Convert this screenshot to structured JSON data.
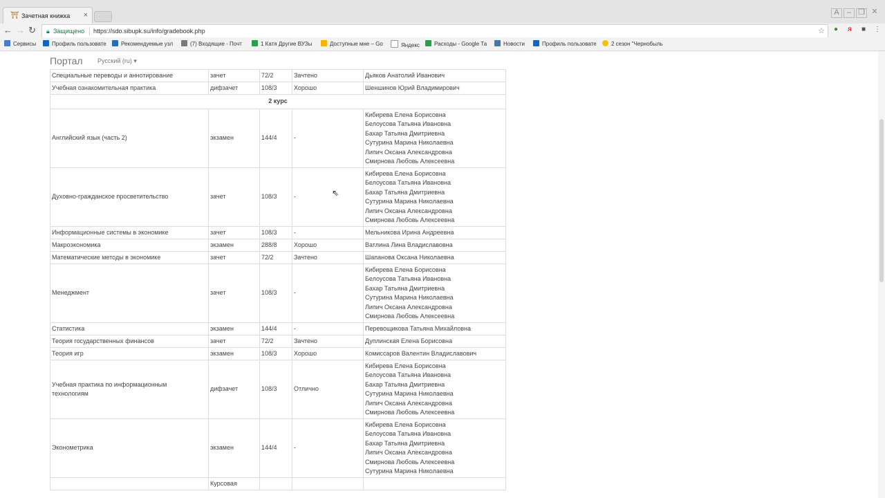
{
  "browser": {
    "tab_title": "Зачетная книжка",
    "tab_icon": "book-icon",
    "secure_label": "Защищено",
    "url": "https://sdo.sibupk.su/info/gradebook.php",
    "bookmarks": [
      "Сервисы",
      "Профиль пользовате",
      "Рекомендуемые узл",
      "(7) Входящие - Почт",
      "1 Катя Другие ВУЗы",
      "Доступные мне – Go",
      "Яндекс",
      "Расходы - Google Та",
      "Новости",
      "Профиль пользовате",
      "2 сезон \"Чернобыль"
    ]
  },
  "portal": {
    "brand": "Портал",
    "language": "Русский (ru) ▾"
  },
  "gradebook": {
    "rows_before": [
      [
        "Специальные переводы и аннотирование",
        "зачет",
        "72/2",
        "Зачтено",
        "Дьяков Анатолий Иванович"
      ],
      [
        "Учебная ознакомительная практика",
        "дифзачет",
        "108/3",
        "Хорошо",
        "Шеншинов Юрий Владимирович"
      ]
    ],
    "year_label": "2 курс",
    "rows": [
      [
        "Английский язык (часть 2)",
        "экзамен",
        "144/4",
        "-",
        "Кибирева Елена Борисовна\nБелоусова Татьяна Ивановна\nБахар Татьяна Дмитриевна\nСутурина Марина Николаевна\nЛипич Оксана Александровна\nСмирнова Любовь Алексеевна"
      ],
      [
        "Духовно-гражданское просветительство",
        "зачет",
        "108/3",
        "-",
        "Кибирева Елена Борисовна\nБелоусова Татьяна Ивановна\nБахар Татьяна Дмитриевна\nСутурина Марина Николаевна\nЛипич Оксана Александровна\nСмирнова Любовь Алексеевна"
      ],
      [
        "Информационные системы в экономике",
        "зачет",
        "108/3",
        "-",
        "Мельникова Ирина Андреевна"
      ],
      [
        "Макроэкономика",
        "экзамен",
        "288/8",
        "Хорошо",
        "Ватлина Лина Владиславовна"
      ],
      [
        "Математические методы в экономике",
        "зачет",
        "72/2",
        "Зачтено",
        "Шапанова Оксана Николаевна"
      ],
      [
        "Менеджмент",
        "зачет",
        "108/3",
        "-",
        "Кибирева Елена Борисовна\nБелоусова Татьяна Ивановна\nБахар Татьяна Дмитриевна\nСутурина Марина Николаевна\nЛипич Оксана Александровна\nСмирнова Любовь Алексеевна"
      ],
      [
        "Статистика",
        "экзамен",
        "144/4",
        "-",
        "Перевощикова Татьяна Михайловна"
      ],
      [
        "Теория государственных финансов",
        "зачет",
        "72/2",
        "Зачтено",
        "Дуплинская Елена Борисовна"
      ],
      [
        "Теория игр",
        "экзамен",
        "108/3",
        "Хорошо",
        "Комиссаров Валентин Владиславович"
      ],
      [
        "Учебная практика по информационным\nтехнологиям",
        "дифзачет",
        "108/3",
        "Отлично",
        "Кибирева Елена Борисовна\nБелоусова Татьяна Ивановна\nБахар Татьяна Дмитриевна\nСутурина Марина Николаевна\nЛипич Оксана Александровна\nСмирнова Любовь Алексеевна"
      ],
      [
        "Эконометрика",
        "экзамен",
        "144/4",
        "-",
        "Кибирева Елена Борисовна\nБелоусова Татьяна Ивановна\nБахар Татьяна Дмитриевна\nЛипич Оксана Александровна\nСмирнова Любовь Алексеевна\nСутурина Марина Николаевна"
      ],
      [
        "",
        "Курсовая",
        "",
        "",
        ""
      ]
    ]
  }
}
